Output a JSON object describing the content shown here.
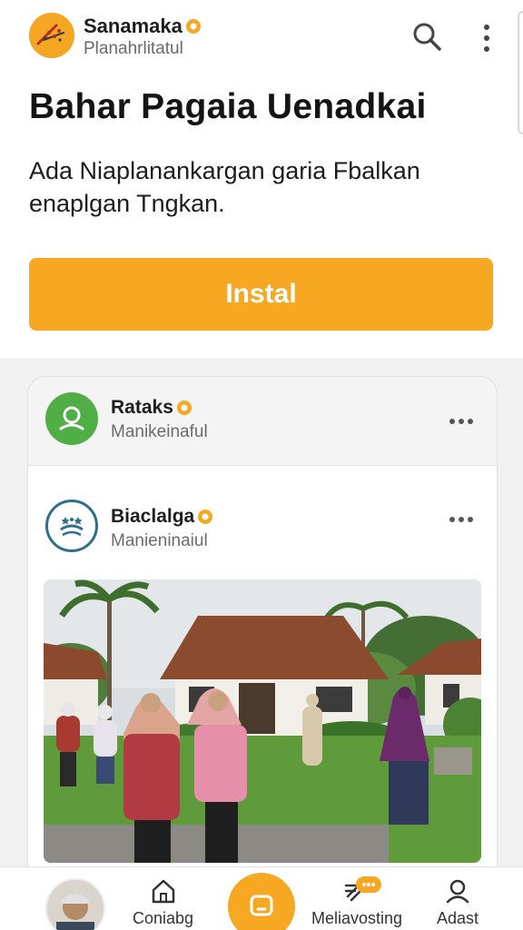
{
  "app": {
    "name": "Sanamaka",
    "subtitle": "Planahrlitatul"
  },
  "promo": {
    "headline": "Bahar Pagaia Uenadkai",
    "description": "Ada Niaplanankargan garia Fbalkan enaplgan Tngkan.",
    "install_label": "Instal"
  },
  "feed": {
    "posts": [
      {
        "name": "Rataks",
        "subtitle": "Manikeinaful"
      },
      {
        "name": "Biaclalga",
        "subtitle": "Manieninaiul"
      }
    ]
  },
  "bottom_nav": {
    "items": [
      {
        "label": "Coniabg"
      },
      {
        "label": "Meliavosting"
      },
      {
        "label": "Adast"
      }
    ]
  },
  "colors": {
    "accent": "#f6a823",
    "avatar_green": "#4fae46",
    "avatar_ring": "#2f6f8a"
  }
}
